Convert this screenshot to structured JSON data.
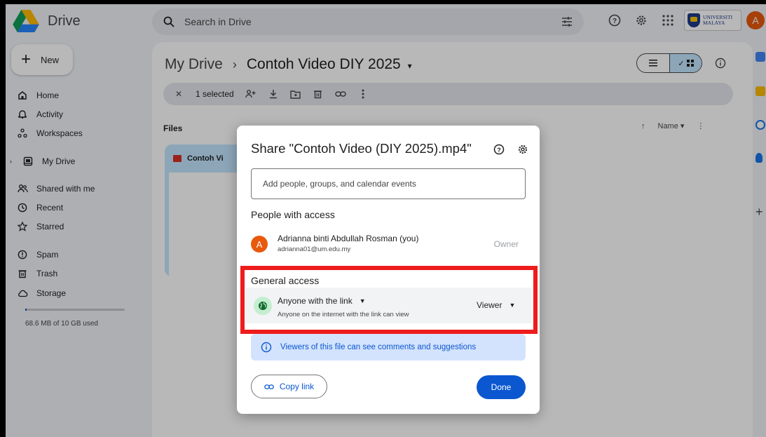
{
  "app": {
    "name": "Drive"
  },
  "search": {
    "placeholder": "Search in Drive"
  },
  "account": {
    "avatar_letter": "A",
    "org_logo_text_1": "UNIVERSITI",
    "org_logo_text_2": "MALAYA"
  },
  "sidebar": {
    "new_label": "New",
    "items": [
      {
        "label": "Home",
        "icon": "home-icon"
      },
      {
        "label": "Activity",
        "icon": "bell-icon"
      },
      {
        "label": "Workspaces",
        "icon": "workspaces-icon"
      },
      {
        "label": "My Drive",
        "icon": "drive-icon"
      },
      {
        "label": "Shared with me",
        "icon": "people-icon"
      },
      {
        "label": "Recent",
        "icon": "clock-icon"
      },
      {
        "label": "Starred",
        "icon": "star-icon"
      },
      {
        "label": "Spam",
        "icon": "spam-icon"
      },
      {
        "label": "Trash",
        "icon": "trash-icon"
      },
      {
        "label": "Storage",
        "icon": "cloud-icon"
      }
    ],
    "storage_text": "68.6 MB of 10 GB used",
    "storage_fraction": 0.0067
  },
  "main": {
    "breadcrumb_root": "My Drive",
    "breadcrumb_sep": "›",
    "breadcrumb_current": "Contoh Video DIY 2025",
    "selection_text": "1 selected",
    "files_label": "Files",
    "sort_label": "Name",
    "file_name": "Contoh Vi"
  },
  "dialog": {
    "title": "Share \"Contoh Video (DIY 2025).mp4\"",
    "add_people_placeholder": "Add people, groups, and calendar events",
    "people_title": "People with access",
    "person": {
      "avatar_letter": "A",
      "name": "Adrianna binti Abdullah Rosman (you)",
      "email": "adrianna01@um.edu.my",
      "role": "Owner"
    },
    "general_access_title": "General access",
    "access_option": "Anyone with the link",
    "access_description": "Anyone on the internet with the link can view",
    "access_role": "Viewer",
    "notice": "Viewers of this file can see comments and suggestions",
    "copy_link_label": "Copy link",
    "done_label": "Done"
  },
  "colors": {
    "accent": "#0b57d0",
    "highlight": "#ee1c1c",
    "avatar": "#e8590c"
  }
}
